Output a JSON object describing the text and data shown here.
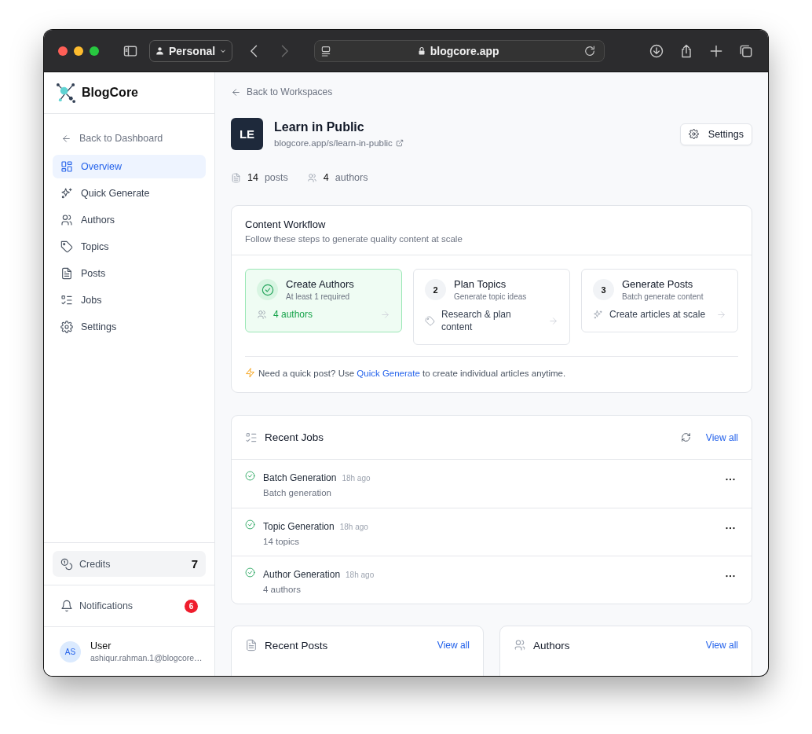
{
  "browser": {
    "profile": "Personal",
    "url": "blogcore.app"
  },
  "sidebar": {
    "brand": "BlogCore",
    "back": "Back to Dashboard",
    "items": [
      {
        "label": "Overview",
        "selected": true
      },
      {
        "label": "Quick Generate",
        "selected": false
      },
      {
        "label": "Authors",
        "selected": false
      },
      {
        "label": "Topics",
        "selected": false
      },
      {
        "label": "Posts",
        "selected": false
      },
      {
        "label": "Jobs",
        "selected": false
      },
      {
        "label": "Settings",
        "selected": false
      }
    ],
    "credits": {
      "label": "Credits",
      "value": "7"
    },
    "notifications": {
      "label": "Notifications",
      "count": "6"
    },
    "user": {
      "initials": "AS",
      "name": "User",
      "email": "ashiqur.rahman.1@blogcore…"
    }
  },
  "main": {
    "back": "Back to Workspaces",
    "workspace": {
      "initials": "LE",
      "name": "Learn in Public",
      "url": "blogcore.app/s/learn-in-public"
    },
    "settings_button": "Settings",
    "stats": [
      {
        "value": "14",
        "label": "posts"
      },
      {
        "value": "4",
        "label": "authors"
      }
    ]
  },
  "workflow": {
    "title": "Content Workflow",
    "subtitle": "Follow these steps to generate quality content at scale",
    "steps": [
      {
        "title": "Create Authors",
        "subtitle": "At least 1 required",
        "action": "4 authors",
        "completed": true
      },
      {
        "number": "2",
        "title": "Plan Topics",
        "subtitle": "Generate topic ideas",
        "action": "Research & plan content",
        "completed": false
      },
      {
        "number": "3",
        "title": "Generate Posts",
        "subtitle": "Batch generate content",
        "action": "Create articles at scale",
        "completed": false
      }
    ],
    "tip": {
      "before": "Need a quick post? Use",
      "link": "Quick Generate",
      "after": "to create individual articles anytime."
    }
  },
  "jobs": {
    "title": "Recent Jobs",
    "view_all": "View all",
    "items": [
      {
        "title": "Batch Generation",
        "time": "18h ago",
        "detail": "Batch generation",
        "completed": true
      },
      {
        "title": "Topic Generation",
        "time": "18h ago",
        "detail": "14 topics",
        "completed": true
      },
      {
        "title": "Author Generation",
        "time": "18h ago",
        "detail": "4 authors",
        "completed": true
      }
    ]
  },
  "panels": [
    {
      "title": "Recent Posts",
      "view_all": "View all"
    },
    {
      "title": "Authors",
      "view_all": "View all"
    }
  ]
}
